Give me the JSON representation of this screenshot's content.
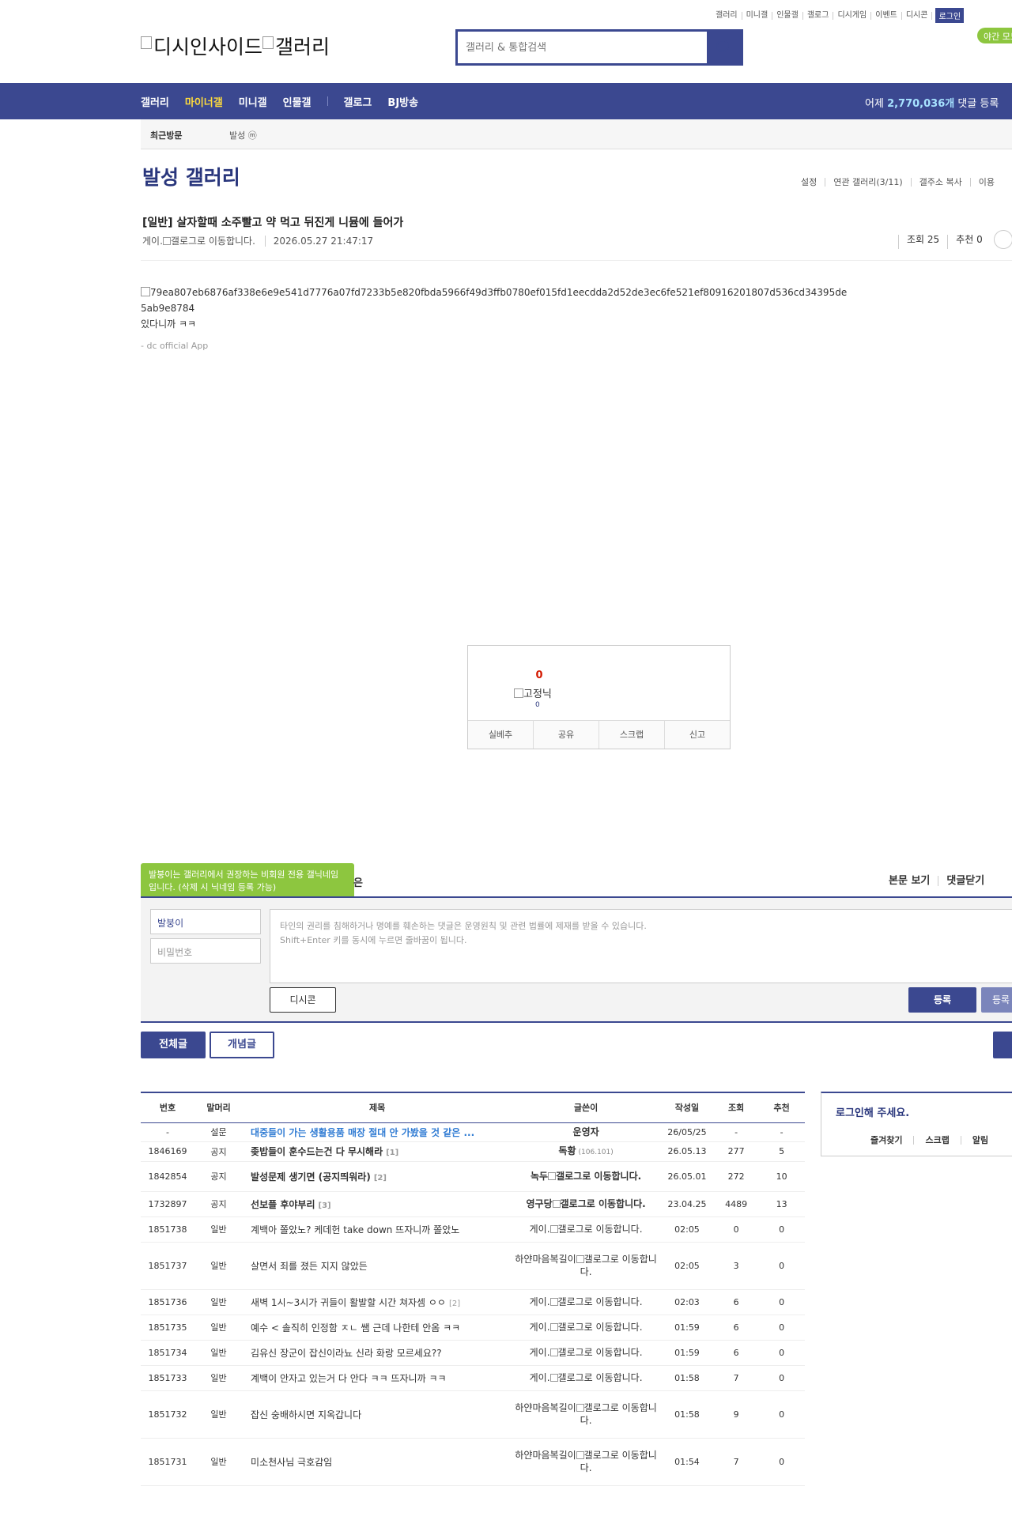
{
  "util_links": [
    "갤러리",
    "미니갤",
    "인물갤",
    "갤로그",
    "디시게임",
    "이벤트",
    "디시콘"
  ],
  "login_label": "로그인",
  "night_mode_label": "야간 모드",
  "logo_text": "디시인사이드",
  "logo_text2": "갤러리",
  "search": {
    "placeholder": "갤러리 & 통합검색"
  },
  "nav": {
    "items": [
      "갤러리",
      "마이너갤",
      "미니갤",
      "인물갤",
      "갤로그",
      "BJ방송"
    ],
    "visit_prefix": "어제 ",
    "visit_count": "2,770,036개",
    "visit_suffix": " 댓글 등록"
  },
  "subbar": {
    "recent": "최근방문",
    "recent_item": "발성 ⓜ"
  },
  "gallery": {
    "title": "발성 갤러리",
    "links": [
      "설정",
      "연관 갤러리(3/11)",
      "갤주소 복사",
      "이용"
    ]
  },
  "post": {
    "title": "[일반] 살자할때 소주빨고 약 먹고 뒤진게 니뮴에 들어가",
    "author": "게이.",
    "author_alt": "갤로그로 이동합니다.",
    "date": "2026.05.27 21:47:17",
    "views": "조회 25",
    "recommend": "추천 0",
    "image_alt": "79ea807eb6876af338e6e9e541d7776a07fd7233b5e820fbda5966f49d3ffb0780ef015fd1eecdda2d52de3ec6fe521ef80916201807d536cd34395de5ab9e8784",
    "body_text": "있다니까 ㅋㅋ",
    "signature": "- dc official App"
  },
  "recommend_box": {
    "count": "0",
    "nick_alt": "고정닉",
    "sub_count": "0",
    "buttons": [
      "실베추",
      "공유",
      "스크랩",
      "신고"
    ]
  },
  "comment": {
    "tooltip": "발붕이는 갤러리에서 권장하는 비회원 전용 갤닉네임입니다. (삭제 시 닉네임 등록 가능)",
    "tooltip_tail": "은",
    "view_links": [
      "본문 보기",
      "댓글닫기"
    ],
    "nick_value": "발붕이",
    "pw_placeholder": "비밀번호",
    "textarea_line1": "타인의 권리를 침해하거나 명예를 훼손하는 댓글은 운영원칙 및 관련 법률에 제재를 받을 수 있습니다.",
    "textarea_line2": "Shift+Enter 키를 동시에 누르면 줄바꿈이 됩니다.",
    "dccon_label": "디시콘",
    "submit_label": "등록",
    "submit2_label": "등록"
  },
  "tabs": {
    "all": "전체글",
    "best": "개념글"
  },
  "list": {
    "headers": [
      "번호",
      "말머리",
      "제목",
      "글쓴이",
      "작성일",
      "조회",
      "추천"
    ],
    "rows": [
      {
        "no": "-",
        "head": "설문",
        "title": "대중들이 가는 생활용품 매장 절대 안 가봤을 것 같은 ...",
        "rc": "",
        "writer": "운영자",
        "ip": "",
        "date": "26/05/25",
        "views": "-",
        "rec": "-",
        "type": "survey"
      },
      {
        "no": "1846169",
        "head": "공지",
        "title": "좆밥들이 훈수드는건 다 무시해라",
        "rc": "[1]",
        "writer": "독황",
        "ip": "(106.101)",
        "date": "26.05.13",
        "views": "277",
        "rec": "5",
        "type": "notice"
      },
      {
        "no": "1842854",
        "head": "공지",
        "title": "발성문제 생기면 (공지띄워라)",
        "rc": "[2]",
        "writer": "녹두",
        "ip": "",
        "alt": "갤로그로 이동합니다.",
        "date": "26.05.01",
        "views": "272",
        "rec": "10",
        "type": "notice"
      },
      {
        "no": "1732897",
        "head": "공지",
        "title": "선보플 후야부리",
        "rc": "[3]",
        "writer": "영구당",
        "ip": "",
        "alt": "갤로그로 이동합니다.",
        "date": "23.04.25",
        "views": "4489",
        "rec": "13",
        "type": "notice"
      },
      {
        "no": "1851738",
        "head": "일반",
        "title": "계백아 쫄았노? 케데헌 take down 뜨자니까 쫄았노",
        "rc": "",
        "writer": "게이.",
        "ip": "",
        "alt": "갤로그로 이동합니다.",
        "date": "02:05",
        "views": "0",
        "rec": "0",
        "type": "normal"
      },
      {
        "no": "1851737",
        "head": "일반",
        "title": "살면서 죄를 졌든 지지 않았든",
        "rc": "",
        "writer": "하얀마음복길이",
        "ip": "",
        "alt": "갤로그로 이동합니다.",
        "date": "02:05",
        "views": "3",
        "rec": "0",
        "type": "normal"
      },
      {
        "no": "1851736",
        "head": "일반",
        "title": "새벽 1시~3시가 귀들이 활발할 시간 쳐자셈 ㅇㅇ",
        "rc": "[2]",
        "writer": "게이.",
        "ip": "",
        "alt": "갤로그로 이동합니다.",
        "date": "02:03",
        "views": "6",
        "rec": "0",
        "type": "normal"
      },
      {
        "no": "1851735",
        "head": "일반",
        "title": "예수 < 솔직히 인정함 ㅈㄴ 쌤 근데 나한테 안옴 ㅋㅋ",
        "rc": "",
        "writer": "게이.",
        "ip": "",
        "alt": "갤로그로 이동합니다.",
        "date": "01:59",
        "views": "6",
        "rec": "0",
        "type": "normal"
      },
      {
        "no": "1851734",
        "head": "일반",
        "title": "김유신 장군이 잡신이라뇨 신라 화랑 모르세요??",
        "rc": "",
        "writer": "게이.",
        "ip": "",
        "alt": "갤로그로 이동합니다.",
        "date": "01:59",
        "views": "6",
        "rec": "0",
        "type": "normal"
      },
      {
        "no": "1851733",
        "head": "일반",
        "title": "계백이 안자고 있는거 다 안다 ㅋㅋ 뜨자니까 ㅋㅋ",
        "rc": "",
        "writer": "게이.",
        "ip": "",
        "alt": "갤로그로 이동합니다.",
        "date": "01:58",
        "views": "7",
        "rec": "0",
        "type": "normal"
      },
      {
        "no": "1851732",
        "head": "일반",
        "title": "잡신 숭배하시면 지옥갑니다",
        "rc": "",
        "writer": "하얀마음복길이",
        "ip": "",
        "alt": "갤로그로 이동합니다.",
        "date": "01:58",
        "views": "9",
        "rec": "0",
        "type": "normal"
      },
      {
        "no": "1851731",
        "head": "일반",
        "title": "미소천사님 극호감임",
        "rc": "",
        "writer": "하얀마음복길이",
        "ip": "",
        "alt": "갤로그로 이동합니다.",
        "date": "01:54",
        "views": "7",
        "rec": "0",
        "type": "normal"
      }
    ]
  },
  "login_box": {
    "title": "로그인해 주세요.",
    "links": [
      "즐겨찾기",
      "스크랩",
      "알림"
    ]
  },
  "colors": {
    "brand": "#3b4890",
    "accent_yellow": "#ffdc3b",
    "night_green": "#8dc63f",
    "rec_red": "#d31900"
  }
}
